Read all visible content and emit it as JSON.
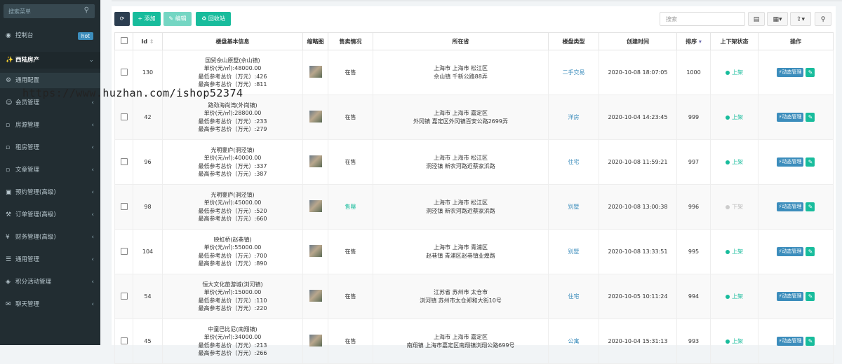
{
  "sidebar": {
    "search_placeholder": "搜索菜单",
    "dashboard": {
      "label": "控制台",
      "badge": "hot"
    },
    "section": {
      "label": "西陆房产"
    },
    "items": [
      {
        "label": "通用配置"
      },
      {
        "label": "会员管理"
      },
      {
        "label": "房源管理"
      },
      {
        "label": "租房管理"
      },
      {
        "label": "文章管理"
      },
      {
        "label": "预约管理(高级)"
      },
      {
        "label": "订单管理(高级)"
      },
      {
        "label": "财务管理(高级)"
      },
      {
        "label": "通用管理"
      },
      {
        "label": "积分活动管理"
      },
      {
        "label": "聊天管理"
      }
    ]
  },
  "toolbar": {
    "add_label": "添加",
    "edit_label": "编辑",
    "recycle_label": "回收站",
    "search_placeholder": "搜索"
  },
  "table": {
    "headers": {
      "id": "Id",
      "info": "楼盘基本信息",
      "thumb": "缩略图",
      "sale": "售卖情况",
      "province": "所在省",
      "type": "楼盘类型",
      "created": "创建时间",
      "sort": "排序",
      "status": "上下架状态",
      "ops": "操作"
    },
    "op_dynamic_label": "动态管理",
    "rows": [
      {
        "id": "130",
        "name": "国贸佘山原墅(佘山镇)",
        "price": "单价(元/㎡):48000.00",
        "min": "最低参考总价（万元）:426",
        "max": "最高参考总价（万元）:811",
        "sale": "在售",
        "addr1": "上海市 上海市 松江区",
        "addr2": "佘山镇 千新公路88弄",
        "type": "二手交易",
        "created": "2020-10-08 18:07:05",
        "sort": "1000",
        "status": "上架"
      },
      {
        "id": "42",
        "name": "路劲海尚湾(外岗镇)",
        "price": "单价(元/㎡):28800.00",
        "min": "最低参考总价（万元）:233",
        "max": "最高参考总价（万元）:279",
        "sale": "在售",
        "addr1": "上海市 上海市 嘉定区",
        "addr2": "外冈镇 嘉定区外冈镇百安公路2699弄",
        "type": "洋房",
        "created": "2020-10-04 14:23:45",
        "sort": "999",
        "status": "上架"
      },
      {
        "id": "96",
        "name": "光明霎庐(洞泾镇)",
        "price": "单价(元/㎡):40000.00",
        "min": "最低参考总价（万元）:337",
        "max": "最高参考总价（万元）:387",
        "sale": "在售",
        "addr1": "上海市 上海市 松江区",
        "addr2": "洞泾镇 新农河路近蔡家浜路",
        "type": "住宅",
        "created": "2020-10-08 11:59:21",
        "sort": "997",
        "status": "上架"
      },
      {
        "id": "98",
        "name": "光明霎庐(洞泾镇)",
        "price": "单价(元/㎡):45000.00",
        "min": "最低参考总价（万元）:520",
        "max": "最高参考总价（万元）:660",
        "sale": "售罄",
        "addr1": "上海市 上海市 松江区",
        "addr2": "洞泾镇 新农河路近蔡家浜路",
        "type": "别墅",
        "created": "2020-10-08 13:00:38",
        "sort": "996",
        "status": "下架"
      },
      {
        "id": "104",
        "name": "映虹桥(赵巷镇)",
        "price": "单价(元/㎡):55000.00",
        "min": "最低参考总价（万元）:700",
        "max": "最高参考总价（万元）:890",
        "sale": "在售",
        "addr1": "上海市 上海市 青浦区",
        "addr2": "赵巷镇 青浦区赵巷镇业煌路",
        "type": "别墅",
        "created": "2020-10-08 13:33:51",
        "sort": "995",
        "status": "上架"
      },
      {
        "id": "54",
        "name": "恒大文化旅游城(浏河镇)",
        "price": "单价(元/㎡):15000.00",
        "min": "最低参考总价（万元）:110",
        "max": "最高参考总价（万元）:220",
        "sale": "在售",
        "addr1": "江苏省 苏州市 太仓市",
        "addr2": "浏河镇 苏州市太仓郑和大街10号",
        "type": "住宅",
        "created": "2020-10-05 10:11:24",
        "sort": "994",
        "status": "上架"
      },
      {
        "id": "45",
        "name": "中童巴比尼(南翔镇)",
        "price": "单价(元/㎡):34000.00",
        "min": "最低参考总价（万元）:213",
        "max": "最高参考总价（万元）:266",
        "sale": "在售",
        "addr1": "上海市 上海市 嘉定区",
        "addr2": "南翔镇 上海市嘉定区南翔镇浏翔公路699号",
        "type": "公寓",
        "created": "2020-10-04 15:31:13",
        "sort": "993",
        "status": "上架"
      }
    ]
  },
  "watermark": "https://www.huzhan.com/ishop52374",
  "colors": {
    "sidebar_bg": "#222d32",
    "accent_green": "#18bc9c",
    "accent_blue": "#3c8dbc",
    "dark_btn": "#2c3e50"
  }
}
